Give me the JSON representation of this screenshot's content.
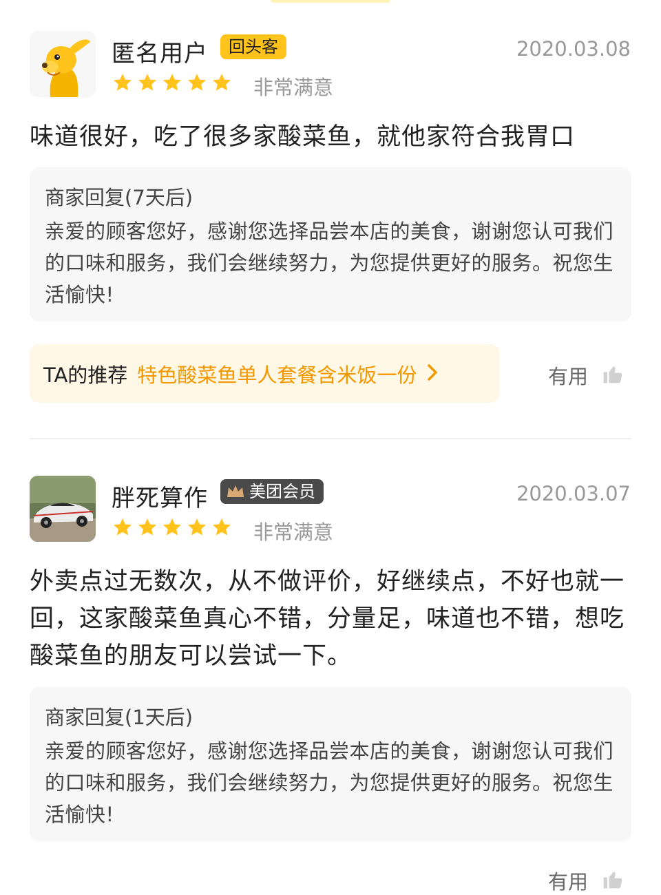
{
  "reviews": [
    {
      "username": "匿名用户",
      "badge": "回头客",
      "date": "2020.03.08",
      "stars": 5,
      "rating_text": "非常满意",
      "content": "味道很好，吃了很多家酸菜鱼，就他家符合我胃口",
      "reply_title": "商家回复(7天后)",
      "reply_body": "亲爱的顾客您好，感谢您选择品尝本店的美食，谢谢您认可我们的口味和服务，我们会继续努力，为您提供更好的服务。祝您生活愉快!",
      "rec_label": "TA的推荐",
      "rec_item": "特色酸菜鱼单人套餐含米饭一份",
      "useful_label": "有用"
    },
    {
      "username": "胖死算作",
      "badge": "美团会员",
      "date": "2020.03.07",
      "stars": 5,
      "rating_text": "非常满意",
      "content": "外卖点过无数次，从不做评价，好继续点，不好也就一回，这家酸菜鱼真心不错，分量足，味道也不错，想吃酸菜鱼的朋友可以尝试一下。",
      "reply_title": "商家回复(1天后)",
      "reply_body": "亲爱的顾客您好，感谢您选择品尝本店的美食，谢谢您认可我们的口味和服务，我们会继续努力，为您提供更好的服务。祝您生活愉快!",
      "useful_label": "有用"
    }
  ],
  "colors": {
    "star": "#ffc31c",
    "accent_orange": "#f39800",
    "badge_yellow": "#ffc31c",
    "badge_dark": "#4a4a4a",
    "reply_bg": "#f7f7f7",
    "rec_bg": "#fff8e6"
  },
  "icons": [
    "kangaroo-avatar-icon",
    "car-avatar-icon",
    "star-icon",
    "crown-icon",
    "chevron-right-icon",
    "thumbs-up-icon"
  ]
}
